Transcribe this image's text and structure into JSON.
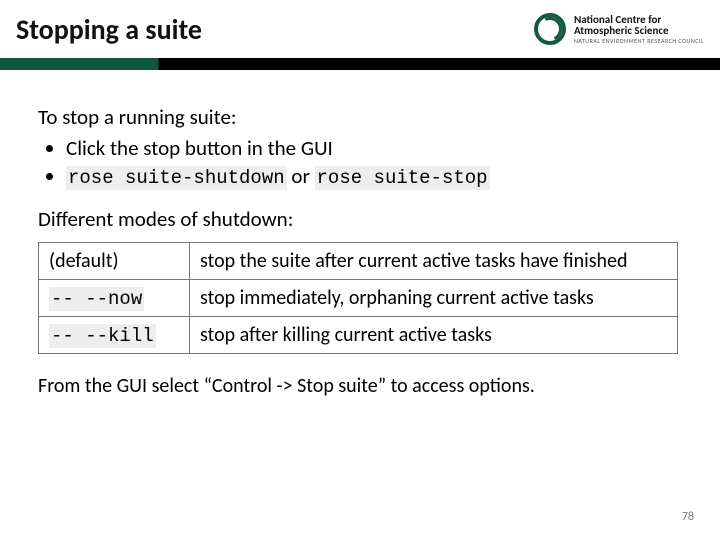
{
  "header": {
    "title": "Stopping a suite",
    "logo": {
      "line1": "National Centre for",
      "line2": "Atmospheric Science",
      "line3": "NATURAL ENVIRONMENT RESEARCH COUNCIL"
    }
  },
  "lead": "To stop a running suite:",
  "bullets": [
    {
      "text": "Click the stop button in the GUI"
    },
    {
      "code1": "rose suite-shutdown",
      "joiner": " or ",
      "code2": "rose suite-stop"
    }
  ],
  "sub": "Different modes of shutdown:",
  "table": [
    {
      "opt_plain": "(default)",
      "desc": "stop the suite after current active tasks have finished"
    },
    {
      "opt_code": "-- --now",
      "desc": "stop immediately, orphaning current active tasks"
    },
    {
      "opt_code": "-- --kill",
      "desc": "stop after killing current active tasks"
    }
  ],
  "foot": "From the GUI select “Control -> Stop suite” to access options.",
  "page": "78"
}
